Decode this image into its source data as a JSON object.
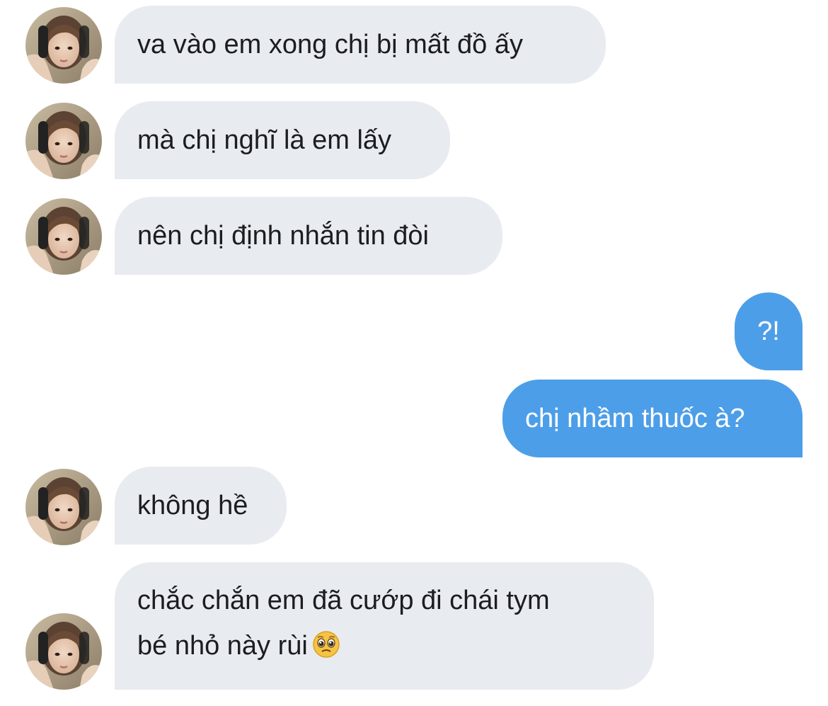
{
  "conversation": {
    "messages": [
      {
        "direction": "incoming",
        "text": "va vào em xong chị bị mất đồ ấy"
      },
      {
        "direction": "incoming",
        "text": "mà chị nghĩ là em lấy"
      },
      {
        "direction": "incoming",
        "text": "nên chị định nhắn tin đòi"
      },
      {
        "direction": "outgoing",
        "text": "?!"
      },
      {
        "direction": "outgoing",
        "text": "chị nhầm thuốc à?"
      },
      {
        "direction": "incoming",
        "text": "không hề"
      },
      {
        "direction": "incoming",
        "line1": "chắc chắn em đã cướp đi chái tym",
        "line2": "bé nhỏ này rùi",
        "emoji": "pleading-face-emoji"
      }
    ]
  },
  "colors": {
    "incoming_bubble": "#e8ebf0",
    "outgoing_bubble": "#4d9ee8",
    "incoming_text": "#1b1d20",
    "outgoing_text": "#ffffff"
  }
}
